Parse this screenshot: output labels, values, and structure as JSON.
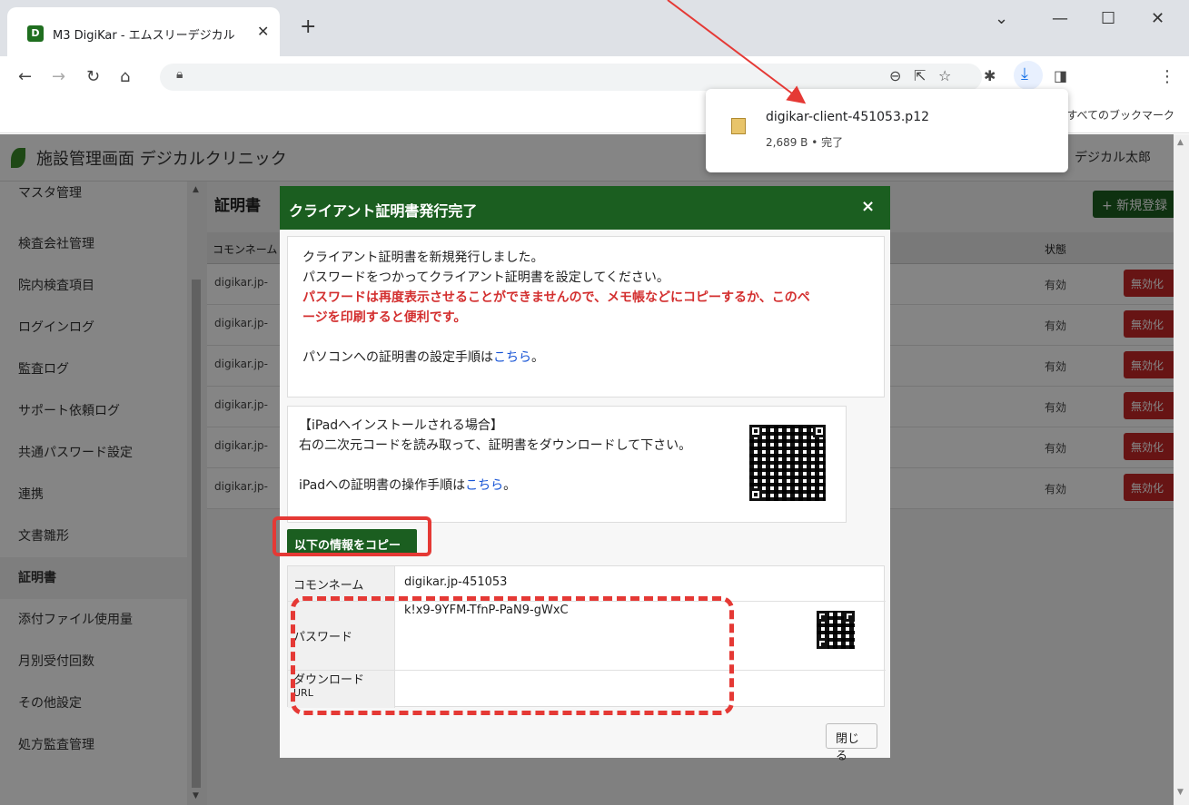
{
  "browser": {
    "tab_title": "M3 DigiKar - エムスリーデジカル",
    "bookmarks_label": "すべてのブックマーク"
  },
  "app": {
    "title": "施設管理画面 デジカルクリニック",
    "user": "デジカル太郎"
  },
  "sidebar": {
    "items": [
      {
        "label": "マスタ管理"
      },
      {
        "label": "検査会社管理"
      },
      {
        "label": "院内検査項目"
      },
      {
        "label": "ログインログ"
      },
      {
        "label": "監査ログ"
      },
      {
        "label": "サポート依頼ログ"
      },
      {
        "label": "共通パスワード設定"
      },
      {
        "label": "連携"
      },
      {
        "label": "文書雛形"
      },
      {
        "label": "証明書"
      },
      {
        "label": "添付ファイル使用量"
      },
      {
        "label": "月別受付回数"
      },
      {
        "label": "その他設定"
      },
      {
        "label": "処方監査管理"
      }
    ],
    "active_index": 9
  },
  "main": {
    "page_title": "証明書",
    "new_button": "+ 新規登録",
    "table": {
      "headers": [
        "コモンネーム",
        "状態"
      ],
      "rows": [
        {
          "common_name": "digikar.jp-",
          "status": "有効",
          "action": "無効化"
        },
        {
          "common_name": "digikar.jp-",
          "status": "有効",
          "action": "無効化"
        },
        {
          "common_name": "digikar.jp-",
          "status": "有効",
          "action": "無効化"
        },
        {
          "common_name": "digikar.jp-",
          "status": "有効",
          "action": "無効化"
        },
        {
          "common_name": "digikar.jp-",
          "status": "有効",
          "action": "無効化"
        },
        {
          "common_name": "digikar.jp-",
          "status": "有効",
          "action": "無効化"
        }
      ]
    }
  },
  "modal": {
    "title": "クライアント証明書発行完了",
    "close_x": "×",
    "msg1": "クライアント証明書を新規発行しました。",
    "msg2": "パスワードをつかってクライアント証明書を設定してください。",
    "warning_line1": "パスワードは再度表示させることができませんので、メモ帳などにコピーするか、このペ",
    "warning_line2": "ージを印刷すると便利です。",
    "pc_text": "パソコンへの証明書の設定手順は",
    "pc_link": "こちら",
    "pc_end": "。",
    "ipad_heading": "【iPadへインストールされる場合】",
    "ipad_text": "右の二次元コードを読み取って、証明書をダウンロードして下さい。",
    "ipad_guide_text": "iPadへの証明書の操作手順は",
    "ipad_link": "こちら",
    "ipad_end": "。",
    "copy_button": "以下の情報をコピー",
    "fields": {
      "common_name_label": "コモンネーム",
      "common_name_value": "digikar.jp-451053",
      "password_label": "パスワード",
      "password_value": "k!x9-9YFM-TfnP-PaN9-gWxC",
      "download_label_1": "ダウンロード",
      "download_label_2": "URL"
    },
    "close_button": "閉じる"
  },
  "download": {
    "filename": "digikar-client-451053.p12",
    "meta": "2,689 B • 完了"
  },
  "colors": {
    "accent_green": "#1b5e20",
    "alert_red": "#e53935"
  }
}
